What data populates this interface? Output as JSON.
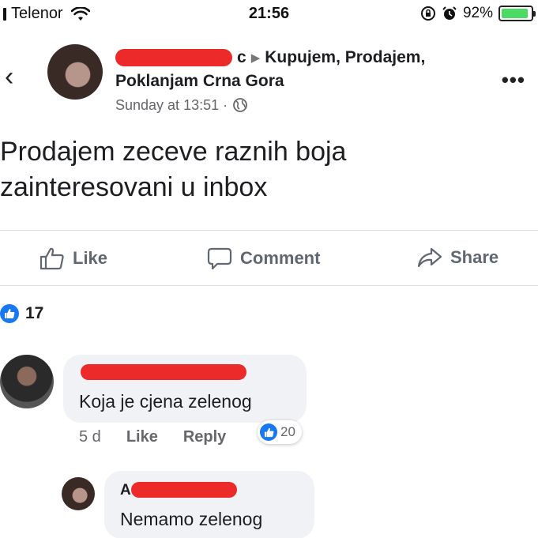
{
  "status_bar": {
    "carrier": "Telenor",
    "time": "21:56",
    "battery_percent": "92%",
    "battery_level": 0.92,
    "icons": [
      "signal-icon",
      "wifi-icon",
      "screen-lock-icon",
      "alarm-icon",
      "battery-icon"
    ]
  },
  "header": {
    "back_icon": "chevron-left-icon",
    "author_suffix": "c",
    "group_name": "Kupujem, Prodajem, Poklanjam Crna Gora",
    "timestamp": "Sunday at 13:51 ·",
    "privacy_icon": "globe-icon",
    "more_icon": "more-icon"
  },
  "post": {
    "line1": "Prodajem zeceve raznih boja",
    "line2": "zainteresovani u inbox"
  },
  "actions": {
    "like": "Like",
    "comment": "Comment",
    "share": "Share"
  },
  "reactions": {
    "count": "17"
  },
  "comments": [
    {
      "author_stub": "",
      "text": "Koja je cjena zelenog",
      "age": "5 d",
      "like": "Like",
      "reply": "Reply",
      "reaction_count": "20"
    },
    {
      "author_stub": "A",
      "text": "Nemamo zelenog"
    }
  ],
  "colors": {
    "redaction": "#ec2a2a",
    "like_blue": "#1877f2",
    "bubble": "#f0f2f5",
    "battery_green": "#4cd964"
  }
}
